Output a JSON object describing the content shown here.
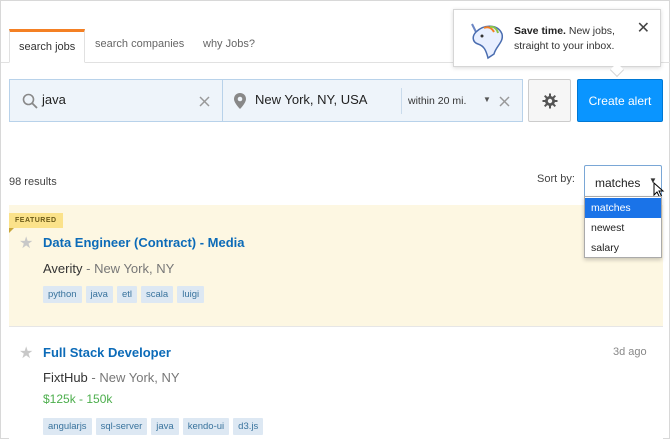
{
  "tabs": [
    {
      "label": "search jobs",
      "active": true
    },
    {
      "label": "search companies",
      "active": false
    },
    {
      "label": "why Jobs?",
      "active": false
    }
  ],
  "popup": {
    "bold": "Save time.",
    "text": " New jobs, straight to your inbox."
  },
  "search": {
    "query": "java",
    "location": "New York, NY, USA",
    "distance": "within 20 mi."
  },
  "buttons": {
    "create_alert": "Create alert"
  },
  "results": {
    "count": "98 results",
    "sort_label": "Sort by:",
    "sort_value": "matches",
    "sort_options": [
      "matches",
      "newest",
      "salary"
    ]
  },
  "colors": {
    "accent": "#f48024",
    "primary": "#0a95ff",
    "link": "#0c6bb8",
    "featured_bg": "#fdf7e2",
    "salary": "#4cae4c"
  },
  "jobs": [
    {
      "badge": "FEATURED",
      "title": "Data Engineer (Contract) - Media",
      "company": "Averity",
      "location": "- New York, NY",
      "tags": [
        "python",
        "java",
        "etl",
        "scala",
        "luigi"
      ]
    },
    {
      "title": "Full Stack Developer",
      "company": "FixtHub",
      "location": "- New York, NY",
      "salary": "$125k - 150k",
      "posted": "3d ago",
      "tags": [
        "angularjs",
        "sql-server",
        "java",
        "kendo-ui",
        "d3.js"
      ]
    }
  ]
}
